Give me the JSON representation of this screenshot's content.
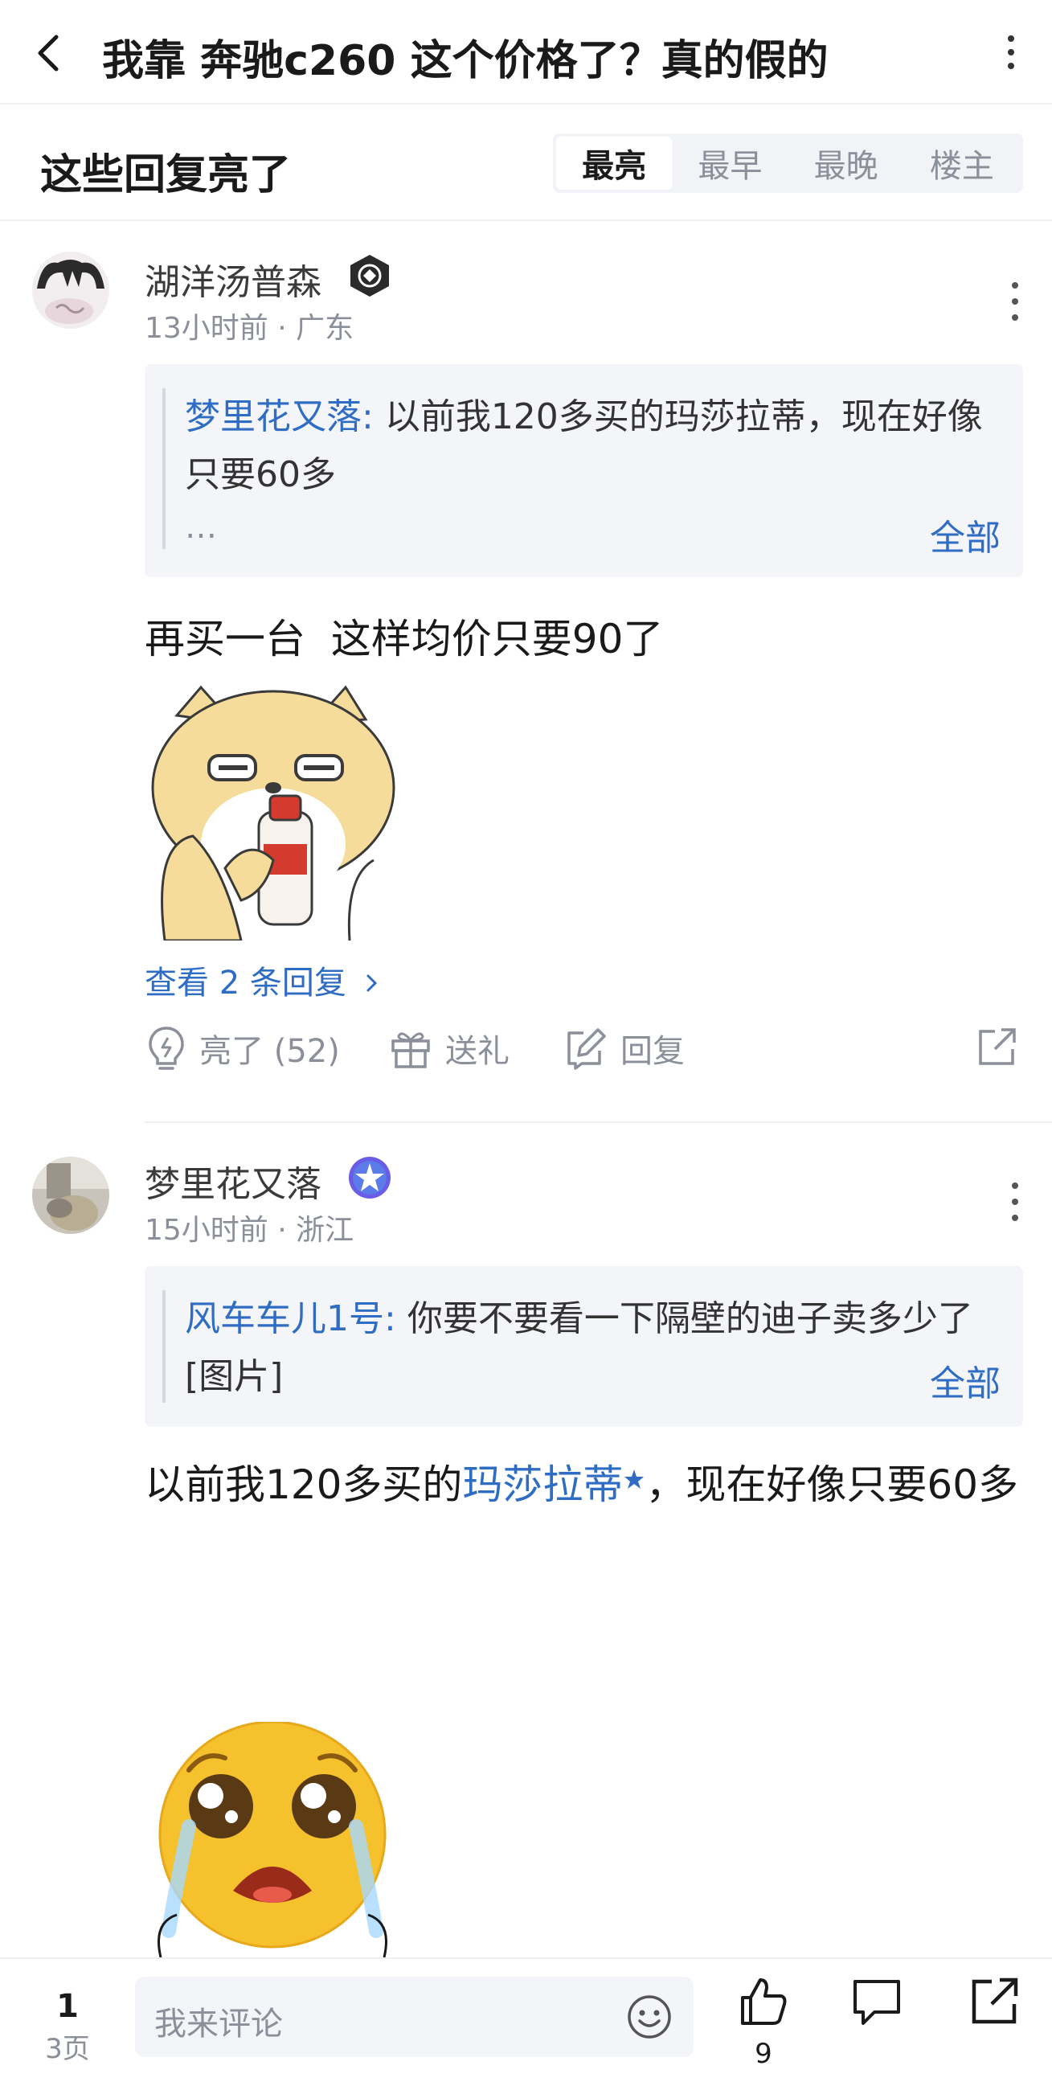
{
  "header": {
    "title": "我靠 奔驰c260 这个价格了？真的假的"
  },
  "section": {
    "title": "这些回复亮了",
    "tabs": [
      {
        "label": "最亮",
        "active": true
      },
      {
        "label": "最早",
        "active": false
      },
      {
        "label": "最晚",
        "active": false
      },
      {
        "label": "楼主",
        "active": false
      }
    ]
  },
  "comments": [
    {
      "username": "湖洋汤普森",
      "meta": "13小时前 · 广东",
      "quote": {
        "author": "梦里花又落:",
        "text": " 以前我120多买的玛莎拉蒂，现在好像只要60多",
        "ellipsis": "…",
        "all_label": "全部"
      },
      "body": "再买一台  这样均价只要90了",
      "view_replies": "查看 2 条回复",
      "actions": {
        "like": "亮了 (52)",
        "gift": "送礼",
        "reply": "回复"
      }
    },
    {
      "username": "梦里花又落",
      "meta": "15小时前 · 浙江",
      "quote": {
        "author": "风车车儿1号:",
        "text": " 你要不要看一下隔壁的迪子卖多少了[图片]",
        "all_label": "全部"
      },
      "body_before": "以前我120多买的",
      "body_link": "玛莎拉蒂",
      "body_after": "，现在好像只要60多"
    }
  ],
  "bottom": {
    "page_current": "1",
    "page_total": "3页",
    "input_placeholder": "我来评论",
    "like_count": "9"
  },
  "colors": {
    "link": "#2f6cc4",
    "muted": "#8a8f99",
    "text": "#1a1a1a"
  }
}
